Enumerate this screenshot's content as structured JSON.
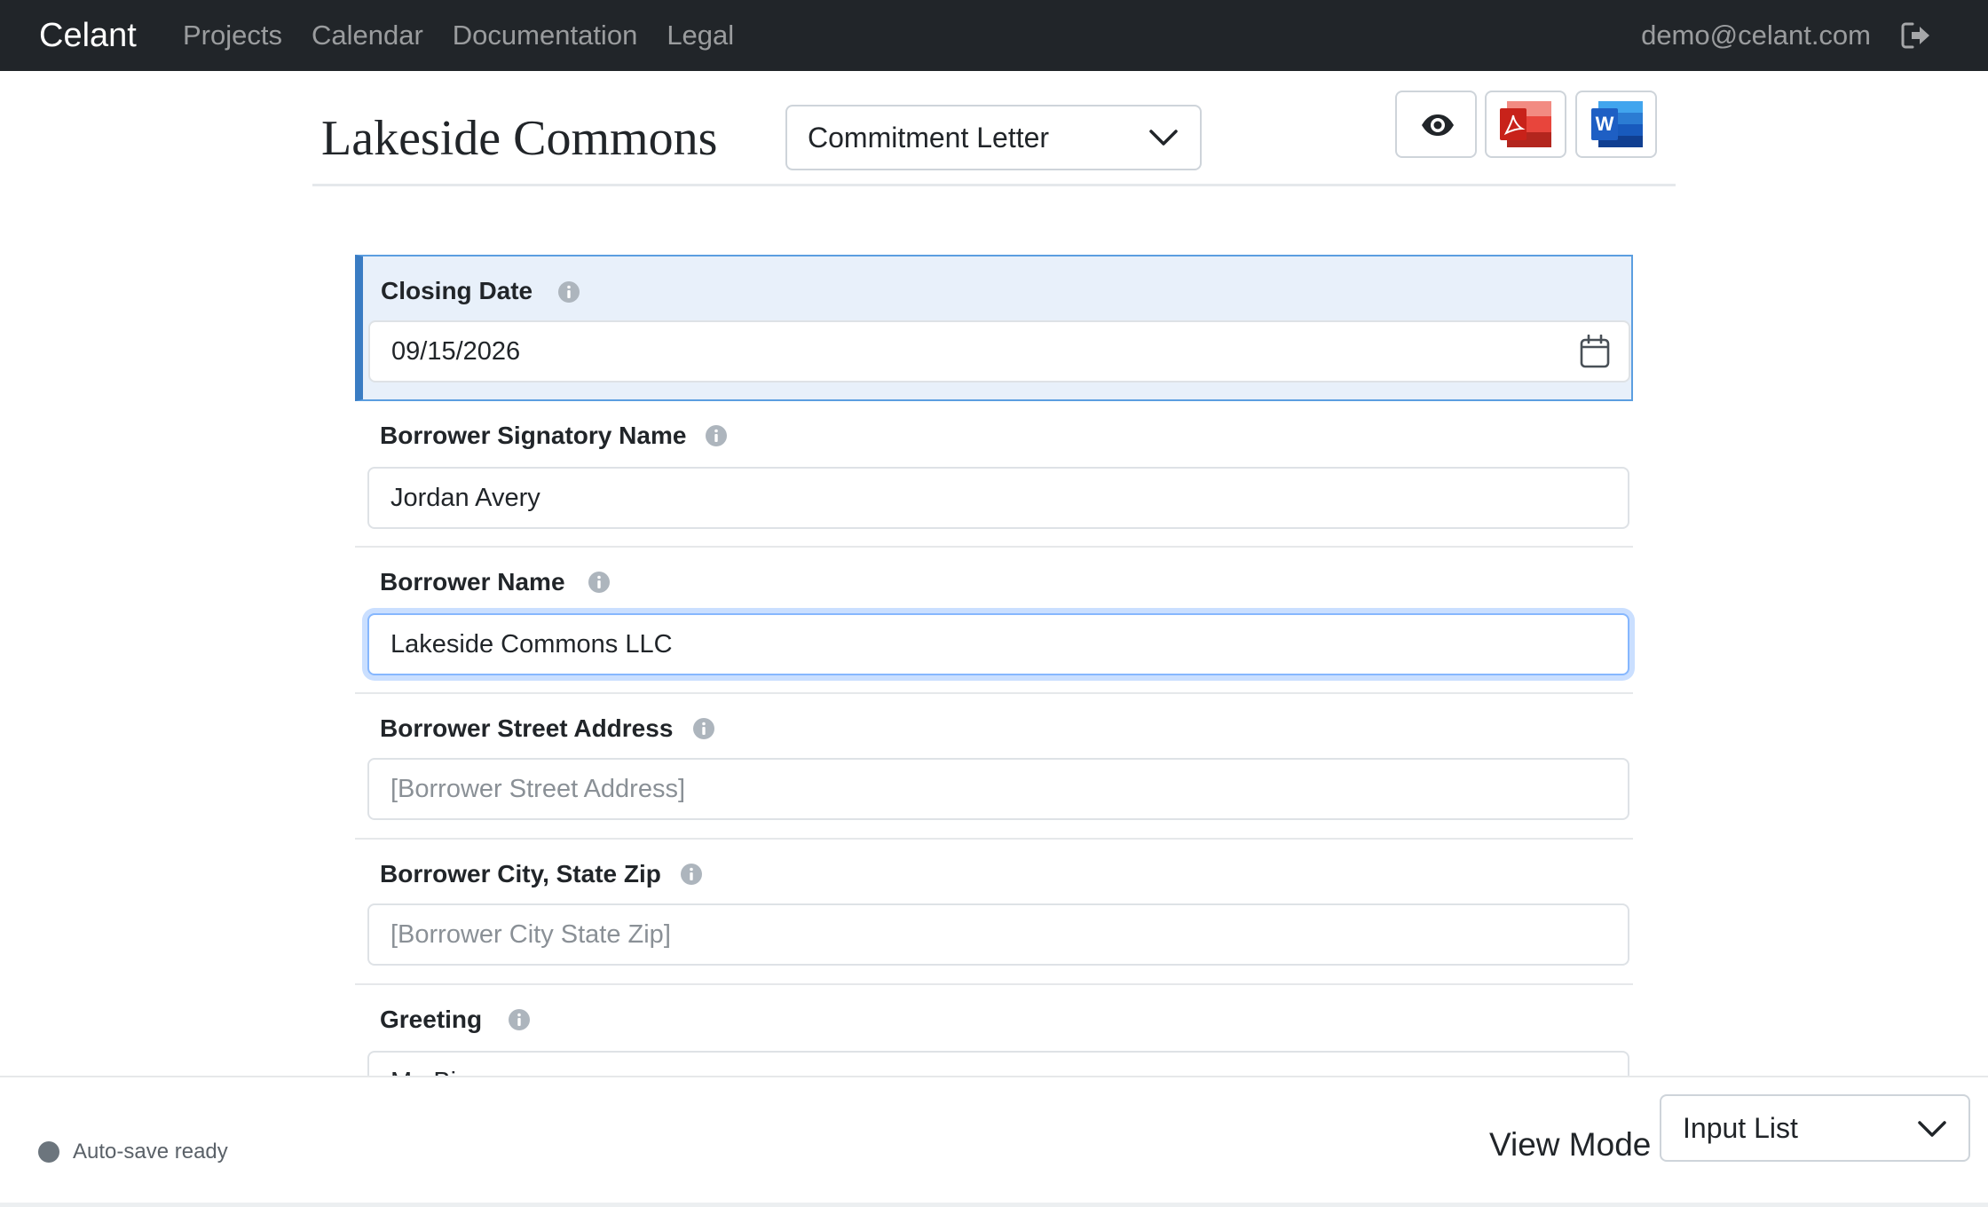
{
  "nav": {
    "brand": "Celant",
    "links": [
      "Projects",
      "Calendar",
      "Documentation",
      "Legal"
    ],
    "email": "demo@celant.com"
  },
  "header": {
    "title": "Lakeside Commons",
    "document_select": "Commitment Letter"
  },
  "fields": [
    {
      "label": "Closing Date",
      "value": "09/15/2026",
      "placeholder": ""
    },
    {
      "label": "Borrower Signatory Name",
      "value": "Jordan Avery",
      "placeholder": ""
    },
    {
      "label": "Borrower Name",
      "value": "Lakeside Commons LLC",
      "placeholder": ""
    },
    {
      "label": "Borrower Street Address",
      "value": "",
      "placeholder": "[Borrower Street Address]"
    },
    {
      "label": "Borrower City, State Zip",
      "value": "",
      "placeholder": "[Borrower City State Zip]"
    },
    {
      "label": "Greeting",
      "value": "Mr. Bi",
      "placeholder": ""
    }
  ],
  "footer": {
    "status": "Auto-save ready",
    "view_mode_label": "View Mode",
    "view_mode_value": "Input List"
  },
  "colors": {
    "navbar": "#212529",
    "active_field_bg": "#e8f0fa",
    "active_field_accent": "#3a7cc3",
    "focus_ring": "#86b7fe",
    "pdf_red": "#d9322b",
    "word_blue": "#1e5fc4"
  }
}
